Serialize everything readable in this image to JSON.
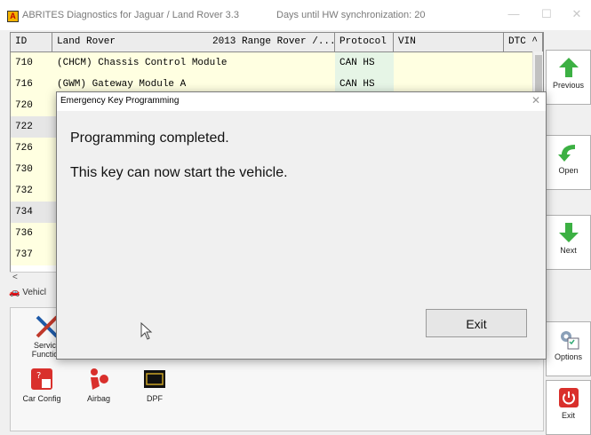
{
  "window": {
    "title": "ABRITES Diagnostics for Jaguar / Land Rover 3.3",
    "sync_text": "Days until HW synchronization: 20",
    "logo_letter": "A",
    "minimize": "—",
    "maximize": "☐",
    "close": "✕"
  },
  "table": {
    "headers": [
      "ID",
      "Land Rover",
      "2013 Range Rover /...",
      "Protocol",
      "VIN",
      "DTC ^"
    ],
    "rows": [
      {
        "id": "710",
        "name": "(CHCM) Chassis Control Module",
        "protocol": "CAN HS"
      },
      {
        "id": "716",
        "name": "(GWM) Gateway Module A",
        "protocol": "CAN HS"
      },
      {
        "id": "720",
        "name": "",
        "protocol": ""
      },
      {
        "id": "722",
        "name": "",
        "protocol": ""
      },
      {
        "id": "726",
        "name": "",
        "protocol": ""
      },
      {
        "id": "730",
        "name": "",
        "protocol": ""
      },
      {
        "id": "732",
        "name": "",
        "protocol": ""
      },
      {
        "id": "734",
        "name": "",
        "protocol": ""
      },
      {
        "id": "736",
        "name": "",
        "protocol": ""
      },
      {
        "id": "737",
        "name": "",
        "protocol": ""
      }
    ],
    "scroll_left": "<"
  },
  "sidebar": {
    "previous": "Previous",
    "open": "Open",
    "next": "Next",
    "options": "Options",
    "exit": "Exit"
  },
  "bottom": {
    "vehicle_tab": "Vehicl",
    "tiles": {
      "service_functions": "Service Function",
      "car_config": "Car Config",
      "airbag": "Airbag",
      "dpf": "DPF"
    }
  },
  "dialog": {
    "title": "Emergency Key Programming",
    "close": "✕",
    "message1": "Programming completed.",
    "message2": "This key can now start the vehicle.",
    "exit_button": "Exit"
  },
  "colors": {
    "row_yellow": "#ffffe1",
    "row_selected": "#e6e6e6",
    "protocol_green": "#e6f5e6",
    "arrow_green": "#3cb043",
    "exit_red": "#d9302c"
  }
}
